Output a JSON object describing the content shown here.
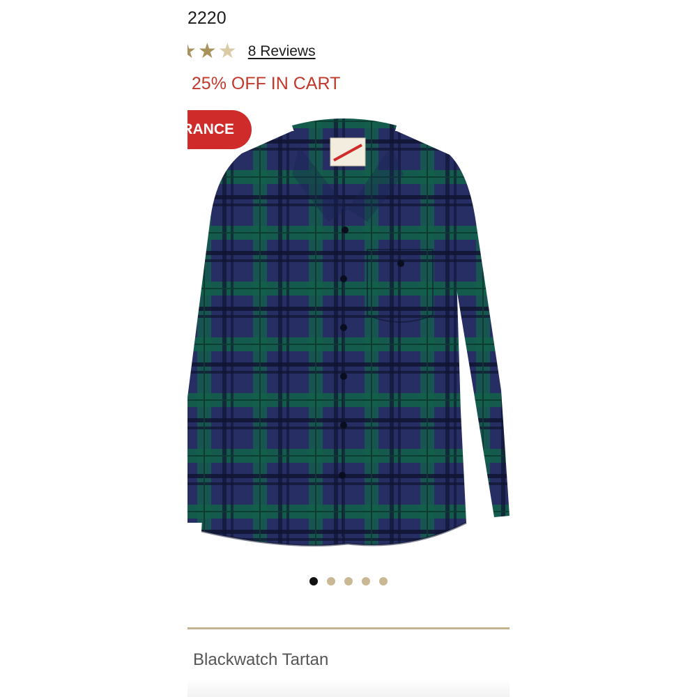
{
  "product": {
    "item_number": "2220",
    "rating_stars": 3,
    "reviews_label": "8 Reviews",
    "promo_text": ". 25% OFF IN CART",
    "badge_label": "RANCE",
    "color_name": "Blackwatch Tartan"
  },
  "carousel": {
    "total_dots": 5,
    "active_index": 0
  },
  "colors": {
    "promo_red": "#c0392b",
    "badge_red": "#cf2b2b",
    "star_filled": "#a8925d",
    "star_empty": "#d9cba6",
    "dot_inactive": "#c9b893",
    "divider": "#c4b28d",
    "tartan_navy": "#262e63",
    "tartan_green": "#13604a"
  }
}
